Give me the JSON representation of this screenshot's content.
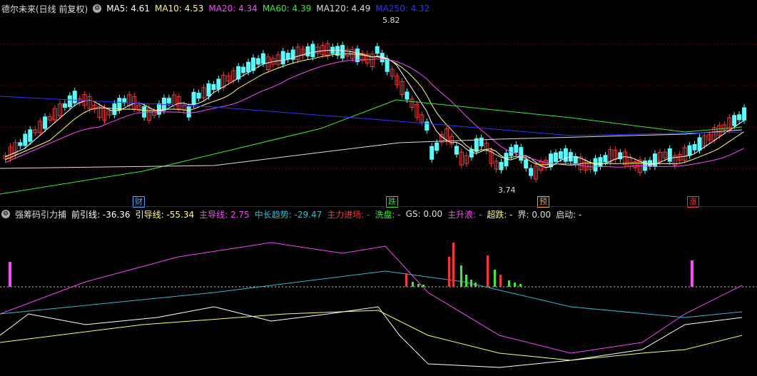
{
  "main_header": {
    "stock": "德尔未来(日线 前复权)",
    "ma5": "MA5: 4.61",
    "ma10": "MA10: 4.53",
    "ma20": "MA20: 4.34",
    "ma60": "MA60: 4.39",
    "ma120": "MA120: 4.49",
    "ma250": "MA250: 4.32"
  },
  "price_labels": {
    "high": "5.82",
    "low": "3.74"
  },
  "markers": [
    {
      "text": "财",
      "color": "#4aa8ff"
    },
    {
      "text": "跌",
      "color": "#33dd33"
    },
    {
      "text": "预",
      "color": "#ff9933"
    },
    {
      "text": "涨",
      "color": "#ff3333"
    }
  ],
  "sub_header": {
    "name": "强筹码引力捕",
    "qianyin": "前引线: -36.36",
    "yindao": "引导线: -55.34",
    "zhudao": "主导线: 2.75",
    "zhongchang": "中长趋势: -29.47",
    "zhuli": "主力进场: -",
    "xipan": "洗盘: -",
    "gs": "GS: 0.00",
    "zhusheng": "主升浪: -",
    "chaodie": "超跌: -",
    "jie": "界: 0.00",
    "qidong": "启动: -"
  },
  "colors": {
    "up": "#ff3333",
    "down": "#54ffff",
    "ma5": "#ffffff",
    "ma10": "#ffff66",
    "ma20": "#ff44ff",
    "ma60": "#33ee33",
    "ma120": "#dddddd",
    "ma250": "#3333ff",
    "zhudao": "#ff44ff",
    "zhongchang": "#33bbcc",
    "yindao": "#ffff66",
    "qianyin": "#ffffff",
    "xipan": "#33ee33",
    "zhuli": "#ff3333"
  }
}
